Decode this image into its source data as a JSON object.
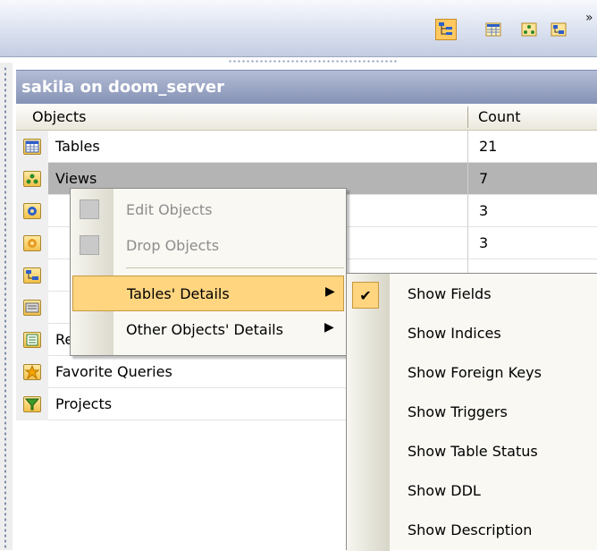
{
  "toolbar": {
    "buttons": [
      {
        "icon": "tree-view-icon",
        "active": true
      },
      {
        "icon": "table-icon",
        "active": false
      },
      {
        "icon": "view-icon",
        "active": false
      },
      {
        "icon": "procedure-icon",
        "active": false
      }
    ],
    "more_glyph": "»"
  },
  "panel": {
    "title": "sakila on doom_server",
    "columns": {
      "objects": "Objects",
      "count": "Count"
    },
    "rows": [
      {
        "icon": "tables-icon",
        "name": "Tables",
        "count": "21",
        "selected": false
      },
      {
        "icon": "views-icon",
        "name": "Views",
        "count": "7",
        "selected": true
      },
      {
        "icon": "procedures-icon",
        "name": "",
        "count": "3",
        "selected": false
      },
      {
        "icon": "functions-icon",
        "name": "",
        "count": "3",
        "selected": false
      },
      {
        "icon": "diagrams-icon",
        "name": "",
        "count": "",
        "selected": false
      },
      {
        "icon": "queries-icon",
        "name": "",
        "count": "",
        "selected": false
      },
      {
        "icon": "reports-icon",
        "name": "Reports",
        "count": "",
        "selected": false
      },
      {
        "icon": "favorite-queries-icon",
        "name": "Favorite Queries",
        "count": "",
        "selected": false
      },
      {
        "icon": "projects-icon",
        "name": "Projects",
        "count": "",
        "selected": false
      }
    ]
  },
  "context_menu": {
    "items": [
      {
        "label": "Edit Objects",
        "disabled": true
      },
      {
        "label": "Drop Objects",
        "disabled": true
      },
      {
        "label": "Tables' Details",
        "submenu_arrow": "▶",
        "highlighted": true
      },
      {
        "label": "Other Objects' Details",
        "submenu_arrow": "▶",
        "highlighted": false
      }
    ]
  },
  "submenu": {
    "check_glyph": "✔",
    "items": [
      {
        "label": "Show Fields",
        "checked": true
      },
      {
        "label": "Show Indices",
        "checked": false
      },
      {
        "label": "Show Foreign Keys",
        "checked": false
      },
      {
        "label": "Show Triggers",
        "checked": false
      },
      {
        "label": "Show Table Status",
        "checked": false
      },
      {
        "label": "Show DDL",
        "checked": false
      },
      {
        "label": "Show Description",
        "checked": false
      }
    ]
  }
}
